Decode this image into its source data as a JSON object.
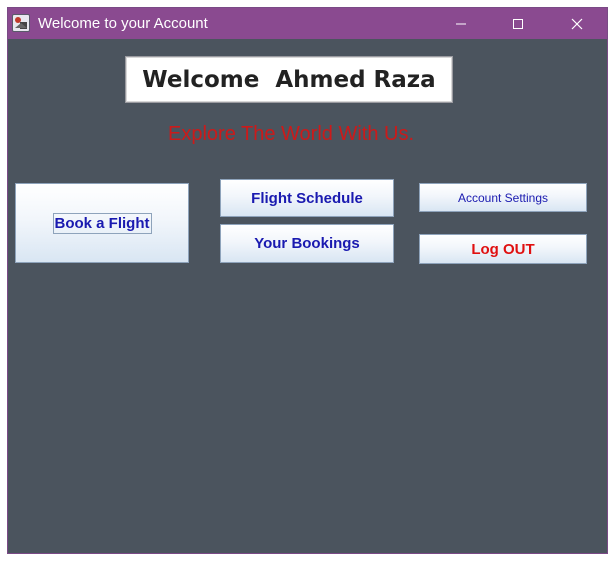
{
  "window": {
    "title": "Welcome to your Account",
    "controls": {
      "minimize": "minimize",
      "maximize": "maximize",
      "close": "close"
    }
  },
  "header": {
    "welcome": "Welcome  Ahmed Raza",
    "tagline": "Explore The World With Us."
  },
  "buttons": {
    "book_flight": "Book a Flight",
    "flight_schedule": "Flight Schedule",
    "your_bookings": "Your Bookings",
    "account_settings": "Account Settings",
    "logout": "Log OUT"
  },
  "colors": {
    "titlebar": "#8a4a90",
    "background": "#4b545e",
    "tagline": "#cc1a1a",
    "button_text": "#1a1ab0",
    "logout_text": "#e01010"
  }
}
